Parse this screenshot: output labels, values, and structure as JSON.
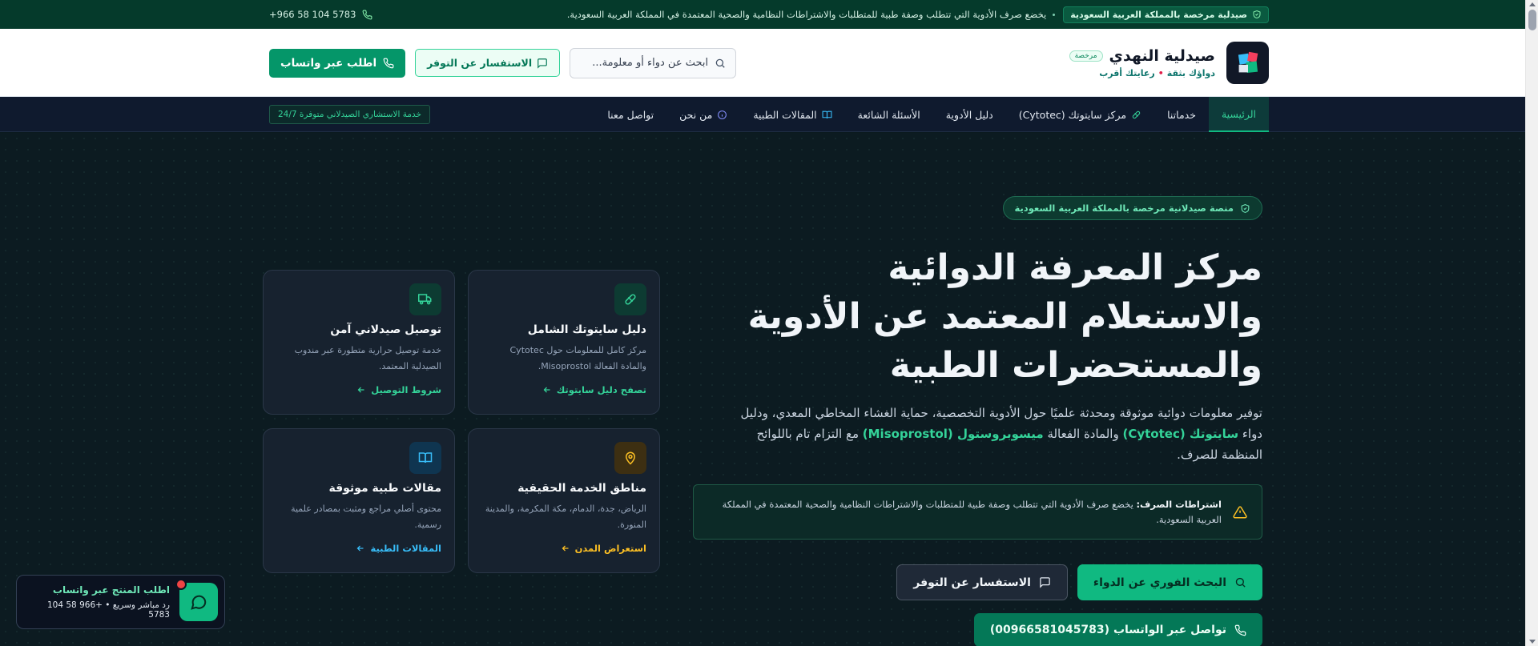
{
  "topbar": {
    "license_badge": "صيدلية مرخصة بالمملكة العربية السعودية",
    "notice": "يخضع صرف الأدوية التي تتطلب وصفة طبية للمتطلبات والاشتراطات النظامية والصحية المعتمدة في المملكة العربية السعودية.",
    "phone": "+966 58 104 5783"
  },
  "header": {
    "brand_name": "صيدلية النهدي",
    "brand_badge": "مرخصة",
    "tagline_a": "دواؤك بثقة",
    "tagline_b": "رعايتك أقرب",
    "search_placeholder": "ابحث عن دواء أو معلومة...",
    "availability_btn": "الاستفسار عن التوفر",
    "whatsapp_btn": "اطلب عبر واتساب"
  },
  "nav": {
    "items": [
      {
        "label": "الرئيسية",
        "active": true
      },
      {
        "label": "خدماتنا"
      },
      {
        "label": "مركز سايتوتك (Cytotec)"
      },
      {
        "label": "دليل الأدوية"
      },
      {
        "label": "الأسئلة الشائعة"
      },
      {
        "label": "المقالات الطبية"
      },
      {
        "label": "من نحن"
      },
      {
        "label": "تواصل معنا"
      }
    ],
    "consult_badge": "خدمة الاستشاري الصيدلاني متوفرة 24/7"
  },
  "hero": {
    "platform_badge": "منصة صيدلانية مرخصة بالمملكة العربية السعودية",
    "title_line1": "مركز المعرفة الدوائية",
    "title_line2": "والاستعلام المعتمد عن الأدوية",
    "title_line3": "والمستحضرات الطبية",
    "desc_part1": "توفير معلومات دوائية موثوقة ومحدثة علميًا حول الأدوية التخصصية، حماية الغشاء المخاطي المعدي، ودليل دواء ",
    "desc_hl1": "سايتوتك (Cytotec)",
    "desc_part2": " والمادة الفعالة ",
    "desc_hl2": "ميسوبروستول (Misoprostol)",
    "desc_part3": " مع التزام تام باللوائح المنظمة للصرف.",
    "alert_title": "اشتراطات الصرف:",
    "alert_text": " يخضع صرف الأدوية التي تتطلب وصفة طبية للمتطلبات والاشتراطات النظامية والصحية المعتمدة في المملكة العربية السعودية.",
    "btn_search": "البحث الفوري عن الدواء",
    "btn_availability": "الاستفسار عن التوفر",
    "btn_whatsapp": "تواصل عبر الواتساب (00966581045783)"
  },
  "cards": [
    {
      "title": "دليل سايتوتك الشامل",
      "desc": "مركز كامل للمعلومات حول Cytotec والمادة الفعالة Misoprostol.",
      "link": "تصفح دليل سايتوتك",
      "color": "#34d399",
      "icon": "pill-icon"
    },
    {
      "title": "توصيل صيدلاني آمن",
      "desc": "خدمة توصيل حرارية متطورة عبر مندوب الصيدلية المعتمد.",
      "link": "شروط التوصيل",
      "color": "#34d399",
      "icon": "truck-icon"
    },
    {
      "title": "مناطق الخدمة الحقيقية",
      "desc": "الرياض، جدة، الدمام، مكة المكرمة، والمدينة المنورة.",
      "link": "استعراض المدن",
      "color": "#fbbf24",
      "icon": "map-pin-icon"
    },
    {
      "title": "مقالات طبية موثوقة",
      "desc": "محتوى أصلي مراجع ومثبت بمصادر علمية رسمية.",
      "link": "المقالات الطبية",
      "color": "#38bdf8",
      "icon": "book-icon"
    }
  ],
  "float_whatsapp": {
    "title": "اطلب المنتج عبر واتساب",
    "sub": "رد مباشر وسريع • +966 58 104 5783"
  }
}
